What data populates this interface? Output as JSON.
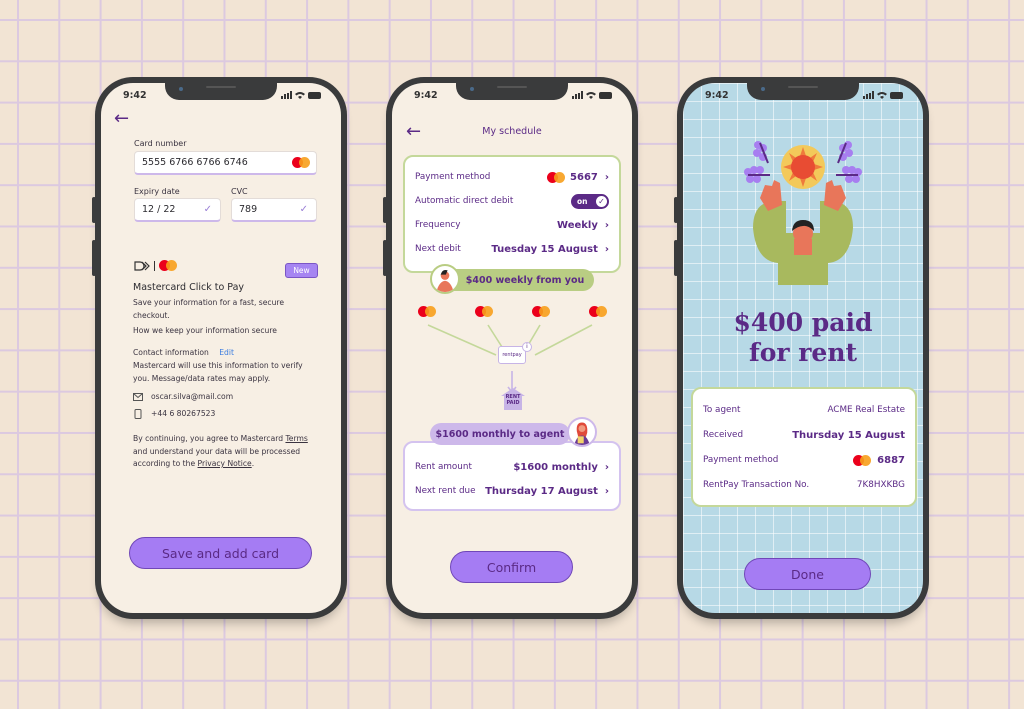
{
  "status_bar": {
    "time": "9:42"
  },
  "phone1": {
    "card_number_label": "Card number",
    "card_number_value": "5555 6766 6766 6746",
    "expiry_label": "Expiry date",
    "expiry_value": "12 / 22",
    "cvc_label": "CVC",
    "cvc_value": "789",
    "new_badge": "New",
    "click_to_pay_title": "Mastercard Click to Pay",
    "click_to_pay_desc": "Save your information for a fast, secure checkout.",
    "secure_link": "How we keep your information secure",
    "contact_label": "Contact information",
    "edit_link": "Edit",
    "contact_desc": "Mastercard will use this information to verify you. Message/data rates may apply.",
    "email": "oscar.silva@mail.com",
    "phone": "+44 6 80267523",
    "terms_prefix": "By continuing, you agree to Mastercard ",
    "terms_link": "Terms",
    "terms_middle": " and understand your data will be processed according to the ",
    "privacy_link": "Privacy Notice",
    "terms_suffix": ".",
    "save_button": "Save and add card"
  },
  "phone2": {
    "title": "My schedule",
    "payment_method_label": "Payment method",
    "payment_method_value": "5667",
    "auto_debit_label": "Automatic direct debit",
    "auto_debit_toggle": "on",
    "frequency_label": "Frequency",
    "frequency_value": "Weekly",
    "next_debit_label": "Next debit",
    "next_debit_value": "Tuesday 15 August",
    "weekly_tag": "$400 weekly from you",
    "rentpay_logo": "rentpay",
    "info_icon": "i",
    "rent_paid_line1": "RENT",
    "rent_paid_line2": "PAID",
    "monthly_tag": "$1600 monthly to agent",
    "rent_amount_label": "Rent amount",
    "rent_amount_value": "$1600 monthly",
    "next_rent_label": "Next rent due",
    "next_rent_value": "Thursday 17 August",
    "confirm_button": "Confirm"
  },
  "phone3": {
    "headline_line1": "$400 paid",
    "headline_line2": "for rent",
    "to_agent_label": "To agent",
    "to_agent_value": "ACME Real Estate",
    "received_label": "Received",
    "received_value": "Thursday 15 August",
    "payment_method_label": "Payment method",
    "payment_method_value": "6887",
    "transaction_label": "RentPay Transaction No.",
    "transaction_value": "7K8HXKBG",
    "done_button": "Done"
  },
  "colors": {
    "accent": "#a57cf3",
    "brand_purple": "#5b2a86",
    "green": "#b9cd83",
    "background": "#f2e4d4"
  }
}
